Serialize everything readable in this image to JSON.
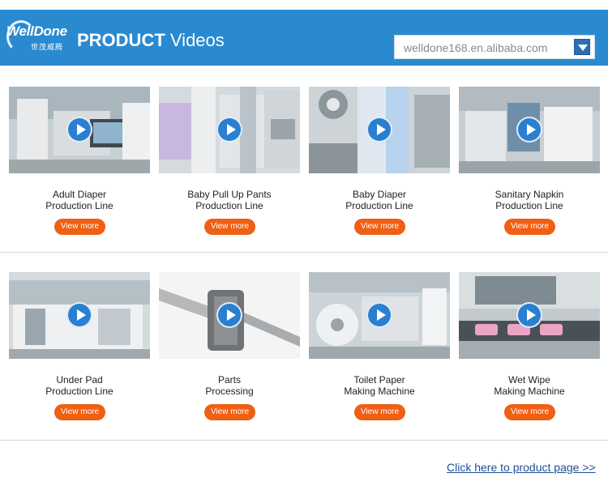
{
  "header": {
    "logo_text": "WellDone",
    "logo_subtitle": "世茂威腾",
    "title_bold": "PRODUCT",
    "title_rest": "Videos",
    "search_value": "welldone168.en.alibaba.com"
  },
  "colors": {
    "header_bg": "#2a8ad0",
    "play_button": "#2a7fd0",
    "view_more_button": "#ef5f14",
    "link": "#1f4f97"
  },
  "products": [
    {
      "line1": "Adult Diaper",
      "line2": "Production Line",
      "button": "View more",
      "thumb": "adult-diaper-machine-thumbnail"
    },
    {
      "line1": "Baby Pull Up Pants",
      "line2": "Production Line",
      "button": "View more",
      "thumb": "pull-up-pants-machine-thumbnail"
    },
    {
      "line1": "Baby Diaper",
      "line2": "Production Line",
      "button": "View more",
      "thumb": "baby-diaper-machine-thumbnail"
    },
    {
      "line1": "Sanitary Napkin",
      "line2": "Production Line",
      "button": "View more",
      "thumb": "sanitary-napkin-machine-thumbnail"
    },
    {
      "line1": "Under Pad",
      "line2": "Production Line",
      "button": "View more",
      "thumb": "under-pad-machine-thumbnail"
    },
    {
      "line1": "Parts",
      "line2": "Processing",
      "button": "View more",
      "thumb": "machined-part-thumbnail"
    },
    {
      "line1": "Toilet Paper",
      "line2": "Making Machine",
      "button": "View more",
      "thumb": "toilet-paper-machine-thumbnail"
    },
    {
      "line1": "Wet Wipe",
      "line2": "Making Machine",
      "button": "View more",
      "thumb": "wet-wipe-machine-thumbnail"
    }
  ],
  "footer": {
    "link_text": "Click here to product page >>"
  }
}
